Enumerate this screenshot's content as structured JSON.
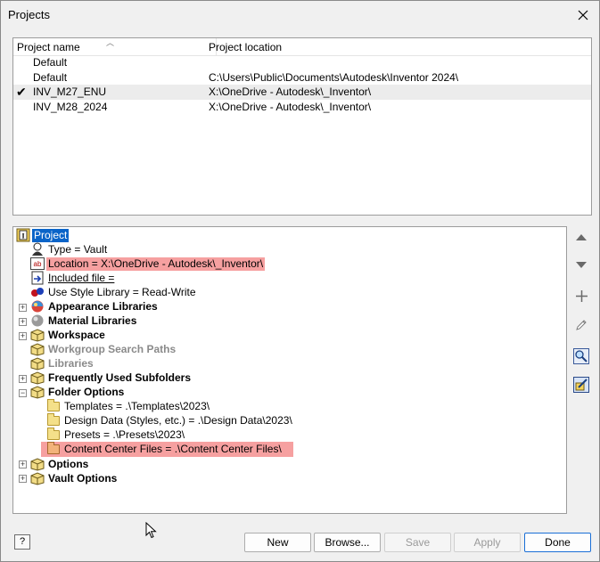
{
  "window": {
    "title": "Projects"
  },
  "project_list": {
    "headers": {
      "name": "Project name",
      "location": "Project location"
    },
    "rows": [
      {
        "name": "Default",
        "location": "",
        "active": false
      },
      {
        "name": "Default",
        "location": "C:\\Users\\Public\\Documents\\Autodesk\\Inventor 2024\\",
        "active": false
      },
      {
        "name": "INV_M27_ENU",
        "location": "X:\\OneDrive - Autodesk\\_Inventor\\",
        "active": true
      },
      {
        "name": "INV_M28_2024",
        "location": "X:\\OneDrive - Autodesk\\_Inventor\\",
        "active": false
      }
    ],
    "active_mark": "✔"
  },
  "tree": {
    "root": "Project",
    "type": "Type = Vault",
    "location": "Location = X:\\OneDrive - Autodesk\\_Inventor\\",
    "included_file": "Included file = ",
    "style_library": "Use Style Library = Read-Write",
    "appearance_libraries": "Appearance Libraries",
    "material_libraries": "Material Libraries",
    "workspace": "Workspace",
    "workgroup_search_paths": "Workgroup Search Paths",
    "libraries": "Libraries",
    "frequently_used_subfolders": "Frequently Used Subfolders",
    "folder_options": "Folder Options",
    "templates": "Templates = .\\Templates\\2023\\",
    "design_data": "Design Data (Styles, etc.) = .\\Design Data\\2023\\",
    "presets": "Presets = .\\Presets\\2023\\",
    "content_center": "Content Center Files = .\\Content Center Files\\",
    "options": "Options",
    "vault_options": "Vault Options",
    "expand_symbol": "+",
    "collapse_symbol": "−"
  },
  "side_tools": [
    "move-up-icon",
    "move-down-icon",
    "add-icon",
    "edit-icon",
    "find-icon",
    "browse-settings-icon"
  ],
  "buttons": {
    "help": "?",
    "new": "New",
    "browse": "Browse...",
    "save": "Save",
    "apply": "Apply",
    "done": "Done"
  },
  "colors": {
    "selection": "#0a64c8",
    "highlight": "#f6a0a0",
    "default_button_border": "#1a6fd6"
  }
}
